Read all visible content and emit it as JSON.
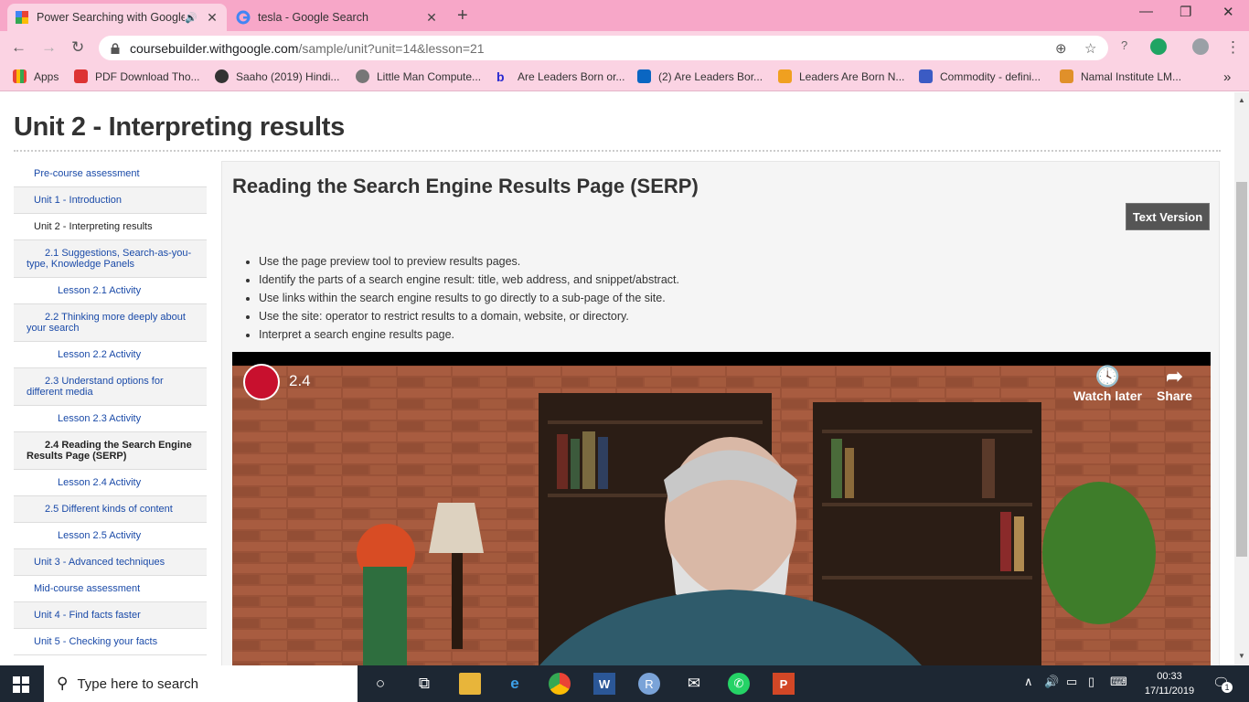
{
  "browser": {
    "tabs": [
      {
        "title": "Power Searching with Google",
        "active": true,
        "audio": true
      },
      {
        "title": "tesla - Google Search",
        "active": false
      }
    ],
    "url_host": "coursebuilder.withgoogle.com",
    "url_path": "/sample/unit?unit=14&lesson=21",
    "bookmarks": [
      "Apps",
      "PDF Download Tho...",
      "Saaho (2019) Hindi...",
      "Little Man Compute...",
      "Are Leaders Born or...",
      "(2) Are Leaders Bor...",
      "Leaders Are Born N...",
      "Commodity - defini...",
      "Namal Institute LM..."
    ],
    "more_bookmarks": "»"
  },
  "page": {
    "unit_title": "Unit 2 - Interpreting results",
    "sidebar": [
      {
        "label": "Pre-course assessment",
        "level": 0,
        "state": "link"
      },
      {
        "label": "Unit 1 - Introduction",
        "level": 0,
        "state": "link"
      },
      {
        "label": "Unit 2 - Interpreting results",
        "level": 0,
        "state": "current"
      },
      {
        "label": "2.1 Suggestions, Search-as-you-type, Knowledge Panels",
        "level": 1,
        "state": "link"
      },
      {
        "label": "Lesson 2.1 Activity",
        "level": 2,
        "state": "link"
      },
      {
        "label": "2.2 Thinking more deeply about your search",
        "level": 1,
        "state": "link"
      },
      {
        "label": "Lesson 2.2 Activity",
        "level": 2,
        "state": "link"
      },
      {
        "label": "2.3 Understand options for different media",
        "level": 1,
        "state": "link"
      },
      {
        "label": "Lesson 2.3 Activity",
        "level": 2,
        "state": "link"
      },
      {
        "label": "2.4 Reading the Search Engine Results Page (SERP)",
        "level": 1,
        "state": "selected"
      },
      {
        "label": "Lesson 2.4 Activity",
        "level": 2,
        "state": "link"
      },
      {
        "label": "2.5 Different kinds of content",
        "level": 1,
        "state": "link"
      },
      {
        "label": "Lesson 2.5 Activity",
        "level": 2,
        "state": "link"
      },
      {
        "label": "Unit 3 - Advanced techniques",
        "level": 0,
        "state": "link"
      },
      {
        "label": "Mid-course assessment",
        "level": 0,
        "state": "link"
      },
      {
        "label": "Unit 4 - Find facts faster",
        "level": 0,
        "state": "link"
      },
      {
        "label": "Unit 5 - Checking your facts",
        "level": 0,
        "state": "link"
      }
    ],
    "lesson_title": "Reading the Search Engine Results Page (SERP)",
    "text_version_label": "Text Version",
    "objectives": [
      "Use the page preview tool to preview results pages.",
      "Identify the parts of a search engine result: title, web address, and snippet/abstract.",
      "Use links within the search engine results to go directly to a sub-page of the site.",
      "Use the site: operator to restrict results to a domain, website, or directory.",
      "Interpret a search engine results page."
    ],
    "video": {
      "number": "2.4",
      "watch_later": "Watch later",
      "share": "Share"
    }
  },
  "taskbar": {
    "search_placeholder": "Type here to search",
    "time": "00:33",
    "date": "17/11/2019",
    "notification_count": "1"
  }
}
